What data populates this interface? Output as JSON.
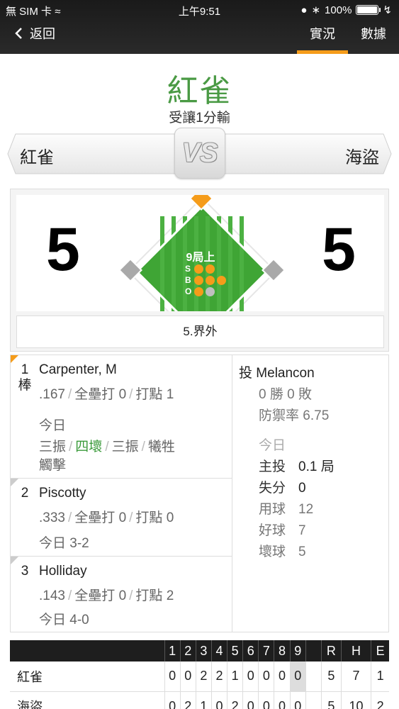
{
  "status": {
    "carrier": "無 SIM 卡",
    "time": "上午9:51",
    "battery": "100%"
  },
  "nav": {
    "back_label": "返回",
    "tabs": [
      {
        "label": "實況",
        "active": true
      },
      {
        "label": "數據",
        "active": false
      }
    ]
  },
  "header": {
    "winner_team": "紅雀",
    "result": "受讓1分輸",
    "away_team": "紅雀",
    "home_team": "海盜",
    "vs": "VS"
  },
  "scoreboard": {
    "away_score": "5",
    "home_score": "5",
    "inning": "9局上",
    "count": {
      "strikes": 2,
      "balls": 3,
      "outs": 1,
      "max_strikes": 2,
      "max_balls": 3,
      "max_outs": 2
    },
    "labels": {
      "s": "S",
      "b": "B",
      "o": "O"
    },
    "last_play": "5.界外"
  },
  "batters": [
    {
      "order": "1",
      "order_suffix": "棒",
      "name": "Carpenter, M",
      "avg": ".167",
      "hr_label": "全壘打",
      "hr": "0",
      "rbi_label": "打點",
      "rbi": "1",
      "today_label": "今日",
      "today_results": [
        "三振",
        "四壞",
        "三振",
        "犧牲"
      ],
      "today_results2": "觸擊"
    },
    {
      "order": "2",
      "name": "Piscotty",
      "avg": ".333",
      "hr_label": "全壘打",
      "hr": "0",
      "rbi_label": "打點",
      "rbi": "0",
      "today": "今日 3-2"
    },
    {
      "order": "3",
      "name": "Holliday",
      "avg": ".143",
      "hr_label": "全壘打",
      "hr": "0",
      "rbi_label": "打點",
      "rbi": "2",
      "today": "今日 4-0"
    }
  ],
  "pitcher": {
    "prefix": "投",
    "name": "Melancon",
    "record": "0 勝 0 敗",
    "era": "防禦率 6.75",
    "today_label": "今日",
    "stats": [
      {
        "label": "主投",
        "value": "0.1 局"
      },
      {
        "label": "失分",
        "value": "0"
      },
      {
        "label": "用球",
        "value": "12"
      },
      {
        "label": "好球",
        "value": "7"
      },
      {
        "label": "壞球",
        "value": "5"
      }
    ]
  },
  "linescore": {
    "innings": [
      "1",
      "2",
      "3",
      "4",
      "5",
      "6",
      "7",
      "8",
      "9"
    ],
    "totals_headers": [
      "R",
      "H",
      "E"
    ],
    "rows": [
      {
        "team": "紅雀",
        "innings": [
          "0",
          "0",
          "2",
          "2",
          "1",
          "0",
          "0",
          "0",
          "0"
        ],
        "totals": [
          "5",
          "7",
          "1"
        ]
      },
      {
        "team": "海盜",
        "innings": [
          "0",
          "2",
          "1",
          "0",
          "2",
          "0",
          "0",
          "0",
          "0"
        ],
        "totals": [
          "5",
          "10",
          "2"
        ]
      }
    ]
  },
  "colors": {
    "accent": "#f59c1a",
    "green": "#4a9a44"
  }
}
